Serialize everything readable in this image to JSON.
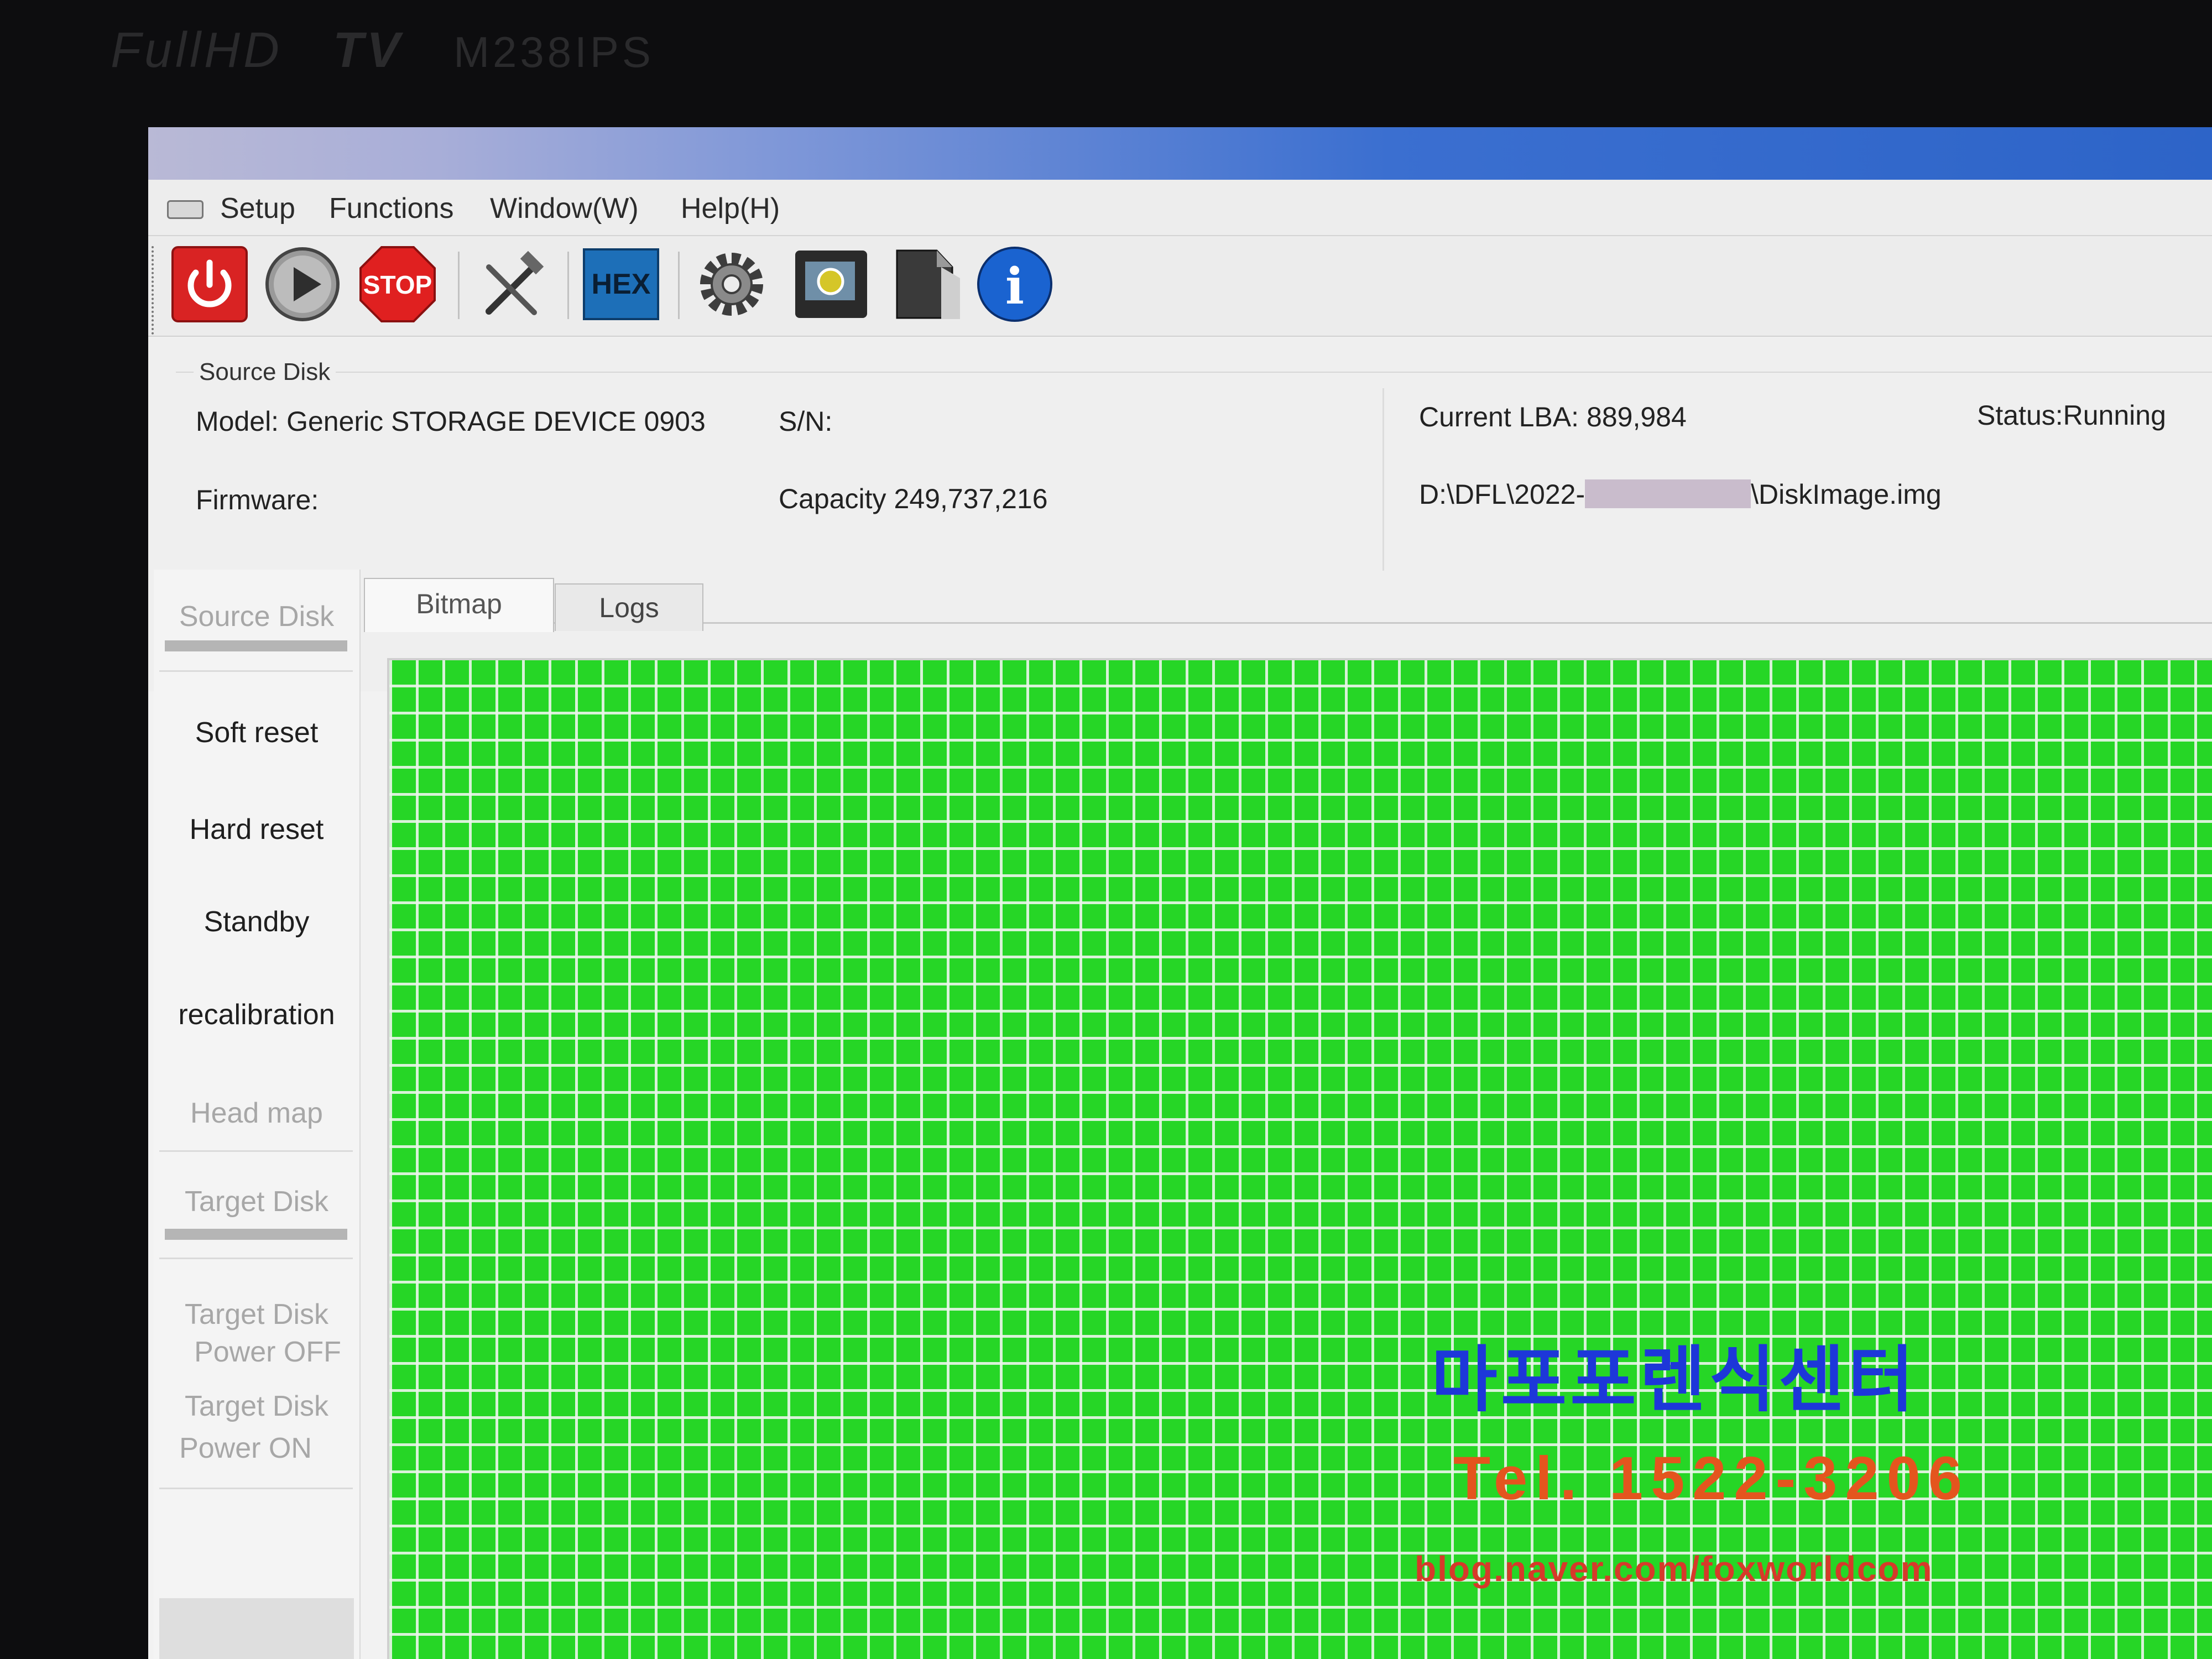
{
  "monitor": {
    "brand_left": "FullHD",
    "brand_middle": "TV",
    "model": "M238IPS"
  },
  "menu": {
    "items": [
      "Setup",
      "Functions",
      "Window(W)",
      "Help(H)"
    ]
  },
  "toolbar": {
    "buttons": [
      {
        "name": "power-icon",
        "label": ""
      },
      {
        "name": "play-icon",
        "label": ""
      },
      {
        "name": "stop-icon",
        "label": "STOP"
      },
      {
        "name": "tools-icon",
        "label": ""
      },
      {
        "name": "hex-icon",
        "label": "HEX"
      },
      {
        "name": "gear-icon",
        "label": ""
      },
      {
        "name": "image-icon",
        "label": ""
      },
      {
        "name": "document-icon",
        "label": ""
      },
      {
        "name": "info-icon",
        "label": "i"
      }
    ]
  },
  "source_disk": {
    "group_title": "Source Disk",
    "model_label": "Model:",
    "model_value": "Generic STORAGE DEVICE  0903",
    "sn_label": "S/N:",
    "sn_value": "",
    "firmware_label": "Firmware:",
    "firmware_value": "",
    "capacity_label": "Capacity",
    "capacity_value": "249,737,216",
    "current_lba_label": "Current LBA:",
    "current_lba_value": "889,984",
    "status_label": "Status:",
    "status_value": "Running",
    "path_prefix": "D:\\DFL\\2022-",
    "path_suffix": "\\DiskImage.img"
  },
  "sidebar": {
    "source_header": "Source Disk",
    "soft_reset": "Soft reset",
    "hard_reset": "Hard reset",
    "standby": "Standby",
    "recalibration": "recalibration",
    "head_map": "Head map",
    "target_header": "Target Disk",
    "target_power_off_1": "Target Disk",
    "target_power_off_2": "Power OFF",
    "target_power_on_1": "Target Disk",
    "target_power_on_2": "Power ON"
  },
  "tabs": [
    {
      "label": "Bitmap",
      "active": true
    },
    {
      "label": "Logs",
      "active": false
    }
  ],
  "watermark": {
    "name": "마포포렌식센터",
    "phone": "Tel. 1522-3206",
    "blog": "blog.naver.com/foxworldcom"
  },
  "colors": {
    "bitmap_green": "#26d626",
    "power_red": "#d92323",
    "stop_red": "#e02020",
    "hex_blue": "#1d6fb8",
    "info_blue": "#1a63d0"
  }
}
